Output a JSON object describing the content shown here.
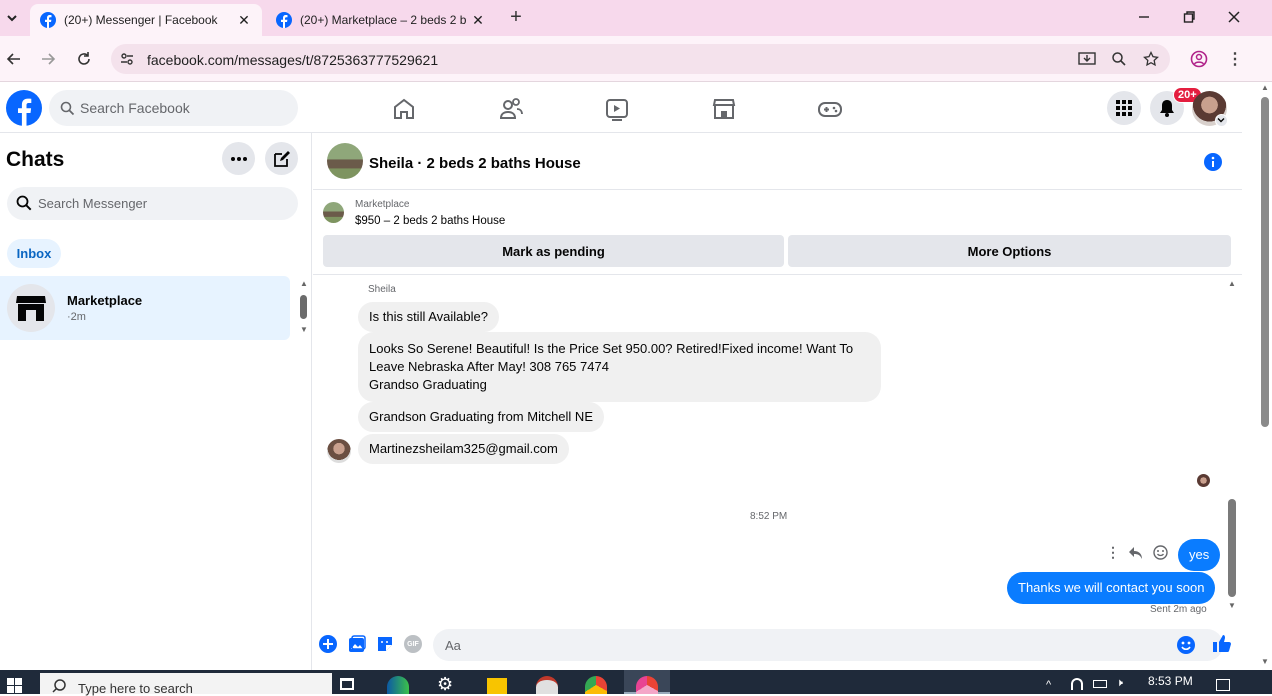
{
  "browser": {
    "tabs": [
      {
        "title": "(20+) Messenger | Facebook"
      },
      {
        "title": "(20+) Marketplace – 2 beds 2 b"
      }
    ],
    "url": "facebook.com/messages/t/8725363777529621"
  },
  "fb_header": {
    "search_placeholder": "Search Facebook",
    "notification_badge": "20+"
  },
  "chats": {
    "title": "Chats",
    "search_placeholder": "Search Messenger",
    "inbox_label": "Inbox",
    "items": [
      {
        "name": "Marketplace",
        "time": "·2m"
      }
    ]
  },
  "conversation": {
    "title": "Sheila · 2 beds 2 baths House",
    "marketplace_label": "Marketplace",
    "listing": "$950 – 2 beds 2 baths House",
    "mark_pending": "Mark as pending",
    "more_options": "More Options",
    "sender_name": "Sheila",
    "messages_incoming": [
      "Is this still Available?",
      "Looks So Serene! Beautiful! Is the Price Set 950.00? Retired!Fixed income! Want To",
      "Leave Nebraska After May! 308 765 7474",
      "Grandso Graduating",
      "Grandson Graduating from Mitchell NE",
      "Martinezsheilam325@gmail.com"
    ],
    "time_divider": "8:52 PM",
    "messages_outgoing": [
      "yes",
      "Thanks we will contact you soon"
    ],
    "sent_status": "Sent 2m ago",
    "composer_placeholder": "Aa",
    "gif_label": "GIF"
  },
  "taskbar": {
    "search_placeholder": "Type here to search",
    "clock": "8:53 PM"
  },
  "colors": {
    "fb_blue": "#0866ff",
    "messenger_blue": "#0a7cff",
    "tabstrip": "#f7d9ec",
    "badge_red": "#e41e3f"
  }
}
